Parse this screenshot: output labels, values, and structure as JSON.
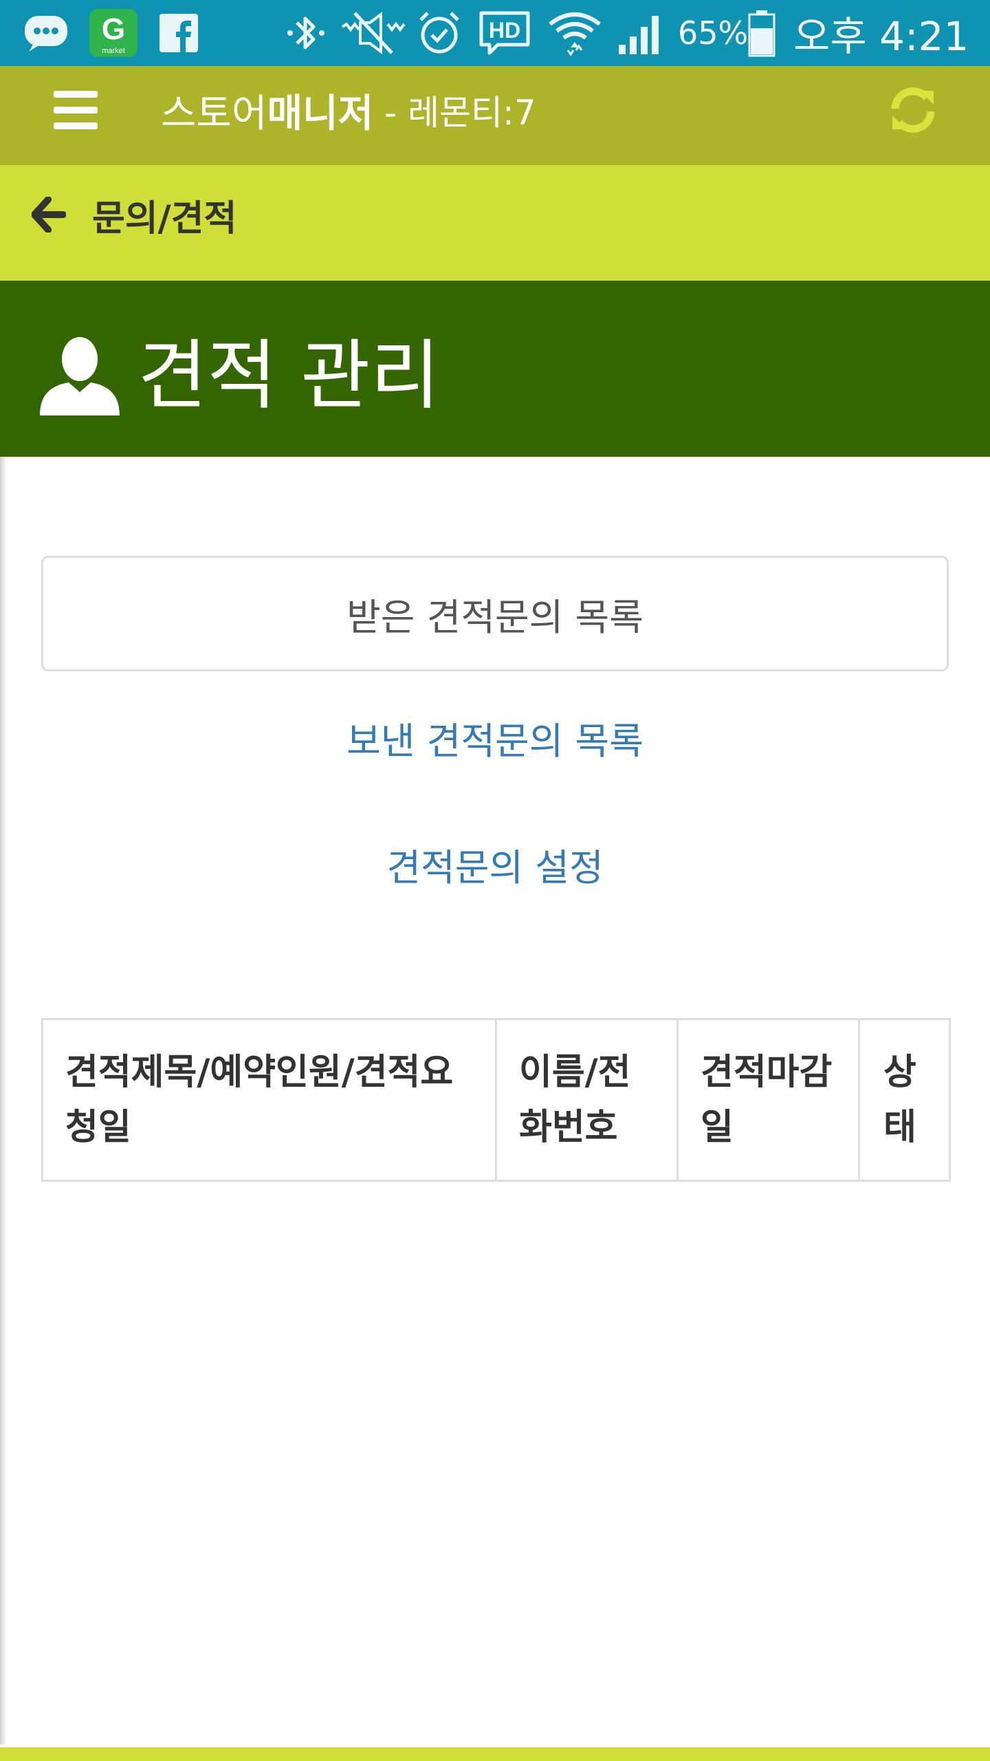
{
  "status_bar": {
    "battery": "65%",
    "time": "오후 4:21",
    "icons": [
      "message-icon",
      "gmarket-app-icon",
      "facebook-icon",
      "bluetooth-icon",
      "mute-icon",
      "alarm-icon",
      "hd-icon",
      "wifi-icon",
      "signal-icon",
      "battery-icon"
    ],
    "gmarket_logo": "G",
    "gmarket_caption": "market",
    "hd_badge": "HD"
  },
  "app_bar": {
    "title_light": "스토어",
    "title_bold": "매니저",
    "subtitle": "- 레몬티:7",
    "menu_icon": "hamburger-menu-icon",
    "refresh_icon": "refresh-icon"
  },
  "breadcrumb": {
    "back_icon": "arrow-left-icon",
    "label": "문의/견적"
  },
  "header": {
    "icon": "user-icon",
    "title": "견적 관리"
  },
  "nav": {
    "received": "받은 견적문의 목록",
    "sent": "보낸 견적문의 목록",
    "settings": "견적문의 설정"
  },
  "table": {
    "columns": [
      "견적제목/예약인원/견적요청일",
      "이름/전화번호",
      "견적마감일",
      "상태"
    ]
  },
  "colors": {
    "status_bar": "#0e93b3",
    "app_bar": "#aeb42a",
    "breadcrumb_bar": "#cfdf37",
    "header_band": "#336600",
    "link": "#337ab7"
  }
}
